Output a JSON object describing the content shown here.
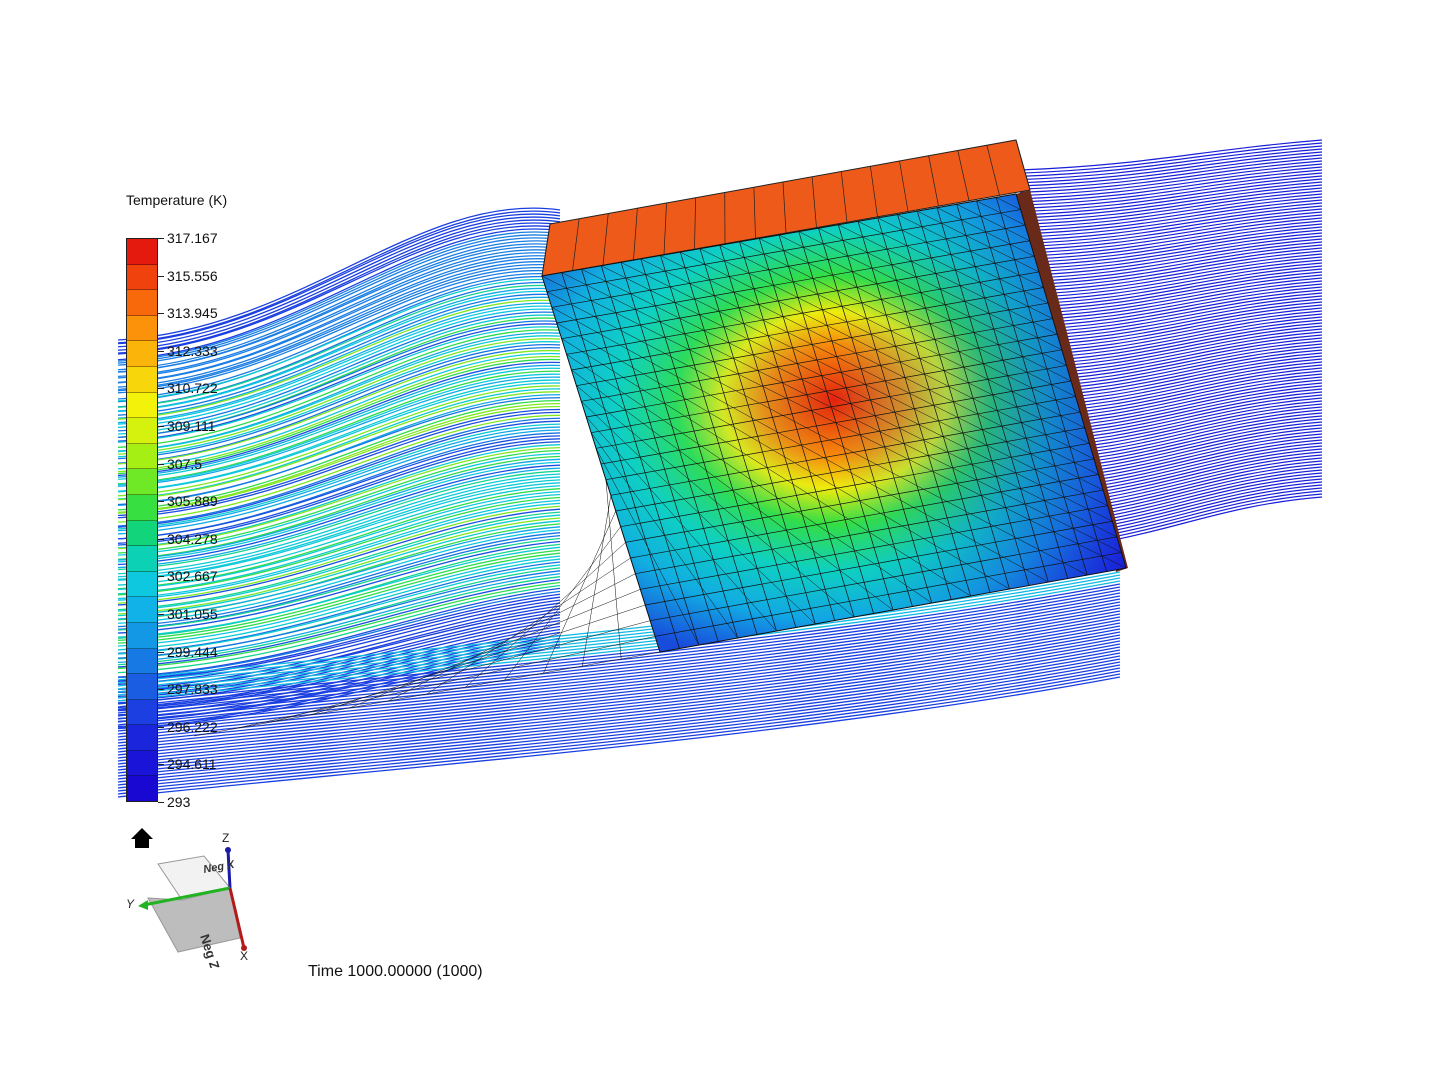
{
  "legend": {
    "title": "Temperature (K)",
    "ticks": [
      "317.167",
      "315.556",
      "313.945",
      "312.333",
      "310.722",
      "309.111",
      "307.5",
      "305.889",
      "304.278",
      "302.667",
      "301.055",
      "299.444",
      "297.833",
      "296.222",
      "294.611",
      "293"
    ],
    "colors": [
      "#e41a0e",
      "#f0420c",
      "#f7690b",
      "#fb920a",
      "#fbb40a",
      "#f7d70b",
      "#f3f20b",
      "#d5f20e",
      "#a6ef14",
      "#6fe826",
      "#37df40",
      "#12d47a",
      "#0cd1b4",
      "#0ec8e0",
      "#10b2e8",
      "#1398e6",
      "#1779e4",
      "#1a5ce2",
      "#1b3fe0",
      "#1a25dc",
      "#1a14d8",
      "#1808d2"
    ]
  },
  "time_label": "Time 1000.00000 (1000)",
  "view_cube": {
    "top_face": "Neg X",
    "front_face": "Neg Z",
    "axes": [
      "Z",
      "Y",
      "X"
    ],
    "colors": {
      "z": "#1a1aa8",
      "y": "#22b322",
      "x": "#b31a1a"
    }
  },
  "icons": {
    "home": "home-icon"
  }
}
